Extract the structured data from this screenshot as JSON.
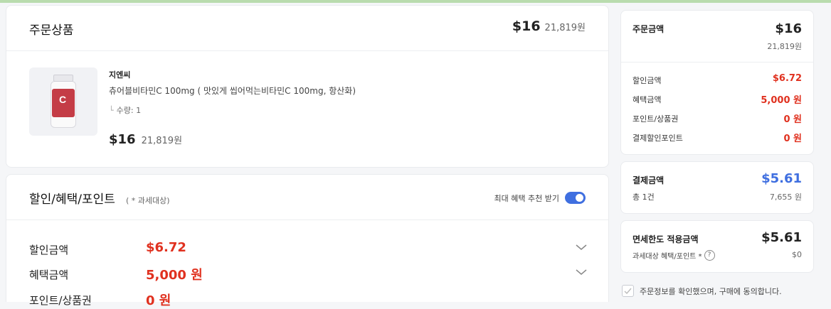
{
  "order": {
    "title": "주문상품",
    "total_usd": "$16",
    "total_krw": "21,819원",
    "product": {
      "brand": "지엔씨",
      "name": "츄어블비타민C 100mg ( 맛있게 씹어먹는비타민C 100mg, 항산화)",
      "branch_glyph": "└",
      "quantity": "수량: 1",
      "price_usd": "$16",
      "price_krw": "21,819원"
    }
  },
  "discount": {
    "title": "할인/혜택/포인트",
    "note": "( * 과세대상)",
    "recommend_label": "최대 혜택 추천 받기",
    "recommend_on": true,
    "rows": [
      {
        "label": "할인금액",
        "value": "$6.72"
      },
      {
        "label": "혜택금액",
        "value": "5,000 원"
      },
      {
        "label": "포인트/상품권",
        "value": "0 원"
      }
    ]
  },
  "summary": {
    "title": "주문금액",
    "total_usd": "$16",
    "total_krw": "21,819원",
    "rows": [
      {
        "label": "할인금액",
        "value": "$6.72"
      },
      {
        "label": "혜택금액",
        "value": "5,000 원"
      },
      {
        "label": "포인트/상품권",
        "value": "0 원"
      },
      {
        "label": "결제할인포인트",
        "value": "0 원"
      }
    ]
  },
  "payment": {
    "title": "결제금액",
    "total_usd": "$5.61",
    "count": "총 1건",
    "total_krw": "7,655 원"
  },
  "duty_free": {
    "title": "면세한도 적용금액",
    "total_usd": "$5.61",
    "sub_label": "과세대상 혜택/포인트 *",
    "sub_value": "$0"
  },
  "agreement": {
    "text": "주문정보를 확인했으며, 구매에 동의합니다."
  },
  "colors": {
    "accent_blue": "#3f6fe0",
    "discount_red": "#e0311f"
  }
}
